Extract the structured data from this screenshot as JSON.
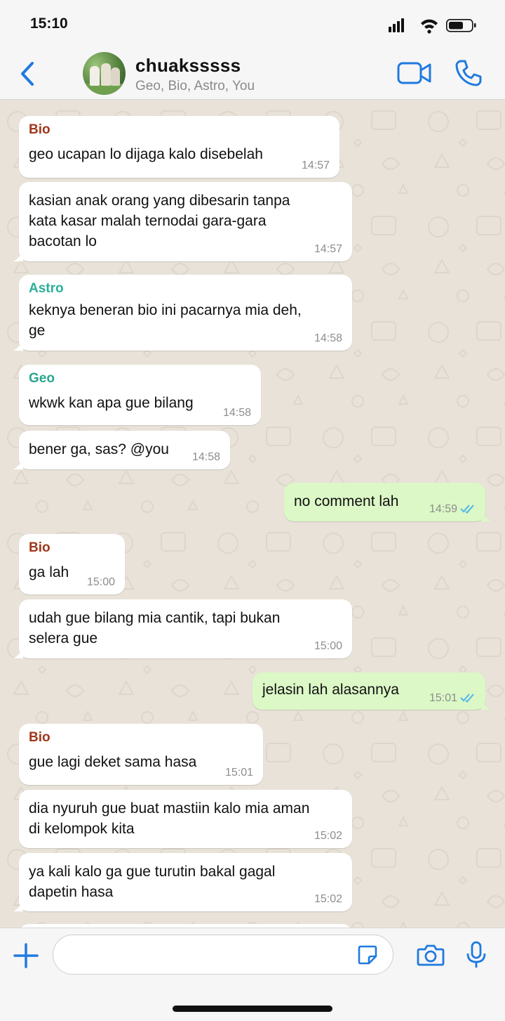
{
  "status_bar": {
    "time": "15:10"
  },
  "header": {
    "back_label": "Back",
    "chat_name": "chuaksssss",
    "members": "Geo, Bio, Astro, You"
  },
  "colors": {
    "accent": "#1f7ae0",
    "bio": "#a0371c",
    "astro": "#2ab098",
    "geo": "#2aa58e",
    "outgoing_bubble": "#dbf8c6",
    "read_ticks": "#4fb6ec"
  },
  "messages": [
    {
      "direction": "in",
      "sender": "Bio",
      "text": "geo ucapan lo dijaga kalo disebelah",
      "time": "14:57"
    },
    {
      "direction": "in",
      "sender": "",
      "text": "kasian anak orang yang dibesarin tanpa\nkata kasar malah ternodai gara-gara\nbacotan lo",
      "time": "14:57"
    },
    {
      "direction": "in",
      "sender": "Astro",
      "text": "keknya beneran bio ini pacarnya mia deh,\nge",
      "time": "14:58"
    },
    {
      "direction": "in",
      "sender": "Geo",
      "text": "wkwk kan apa gue bilang",
      "time": "14:58"
    },
    {
      "direction": "in",
      "sender": "",
      "text": "bener ga, sas? @you",
      "time": "14:58"
    },
    {
      "direction": "out",
      "sender": "",
      "text": "no comment lah",
      "time": "14:59",
      "status": "read"
    },
    {
      "direction": "in",
      "sender": "Bio",
      "text": "ga lah",
      "time": "15:00"
    },
    {
      "direction": "in",
      "sender": "",
      "text": "udah gue bilang mia cantik, tapi bukan\nselera gue",
      "time": "15:00"
    },
    {
      "direction": "out",
      "sender": "",
      "text": "jelasin lah alasannya",
      "time": "15:01",
      "status": "read"
    },
    {
      "direction": "in",
      "sender": "Bio",
      "text": "gue lagi deket sama hasa",
      "time": "15:01"
    },
    {
      "direction": "in",
      "sender": "",
      "text": "dia nyuruh gue buat mastiin kalo mia aman\ndi kelompok kita",
      "time": "15:02"
    },
    {
      "direction": "in",
      "sender": "",
      "text": "ya kali kalo ga gue turutin bakal gagal\ndapetin hasa",
      "time": "15:02"
    }
  ],
  "composer": {
    "input_value": "",
    "icons": [
      "plus-icon",
      "sticker-icon",
      "camera-icon",
      "microphone-icon"
    ]
  }
}
